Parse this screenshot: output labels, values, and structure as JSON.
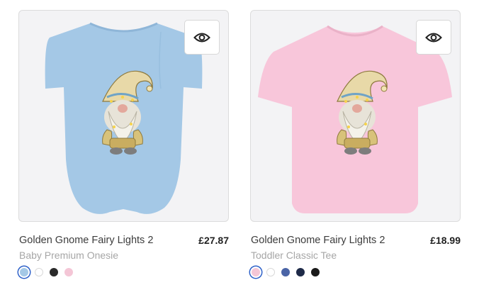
{
  "products": [
    {
      "title": "Golden Gnome Fairy Lights 2",
      "subtitle": "Baby Premium Onesie",
      "price": "£27.87",
      "garment_color": "#a4c8e6",
      "swatches": [
        {
          "color": "#a4c8e6",
          "selected": true
        },
        {
          "color": "#ffffff",
          "selected": false
        },
        {
          "color": "#2a2a2a",
          "selected": false
        },
        {
          "color": "#f4c6d6",
          "selected": false
        }
      ]
    },
    {
      "title": "Golden Gnome Fairy Lights 2",
      "subtitle": "Toddler Classic Tee",
      "price": "£18.99",
      "garment_color": "#f8c6da",
      "swatches": [
        {
          "color": "#f4c6d6",
          "selected": true
        },
        {
          "color": "#ffffff",
          "selected": false
        },
        {
          "color": "#4a64a6",
          "selected": false
        },
        {
          "color": "#1e2a48",
          "selected": false
        },
        {
          "color": "#1a1a1a",
          "selected": false
        }
      ]
    }
  ],
  "icons": {
    "quick_view": "eye-icon"
  }
}
